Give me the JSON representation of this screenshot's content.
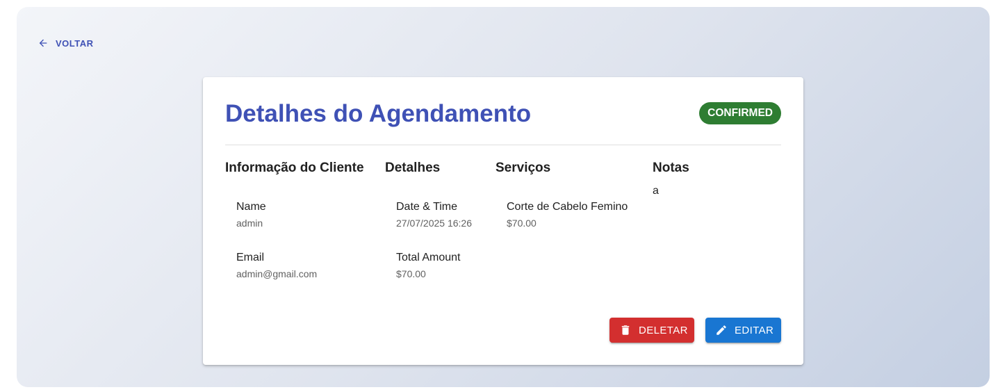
{
  "nav": {
    "back_label": "VOLTAR"
  },
  "card": {
    "title": "Detalhes do Agendamento",
    "status": "CONFIRMED",
    "status_color": "#2e7d32",
    "title_color": "#3f51b5"
  },
  "client": {
    "heading": "Informação do Cliente",
    "name_label": "Name",
    "name_value": "admin",
    "email_label": "Email",
    "email_value": "admin@gmail.com"
  },
  "details": {
    "heading": "Detalhes",
    "datetime_label": "Date & Time",
    "datetime_value": "27/07/2025 16:26",
    "total_label": "Total Amount",
    "total_value": "$70.00"
  },
  "services": {
    "heading": "Serviços",
    "items": [
      {
        "name": "Corte de Cabelo Femino",
        "price": "$70.00"
      }
    ]
  },
  "notes": {
    "heading": "Notas",
    "text": "a"
  },
  "actions": {
    "delete_label": "DELETAR",
    "edit_label": "EDITAR",
    "delete_color": "#d32f2f",
    "edit_color": "#1976d2"
  },
  "icons": {
    "back": "arrow-left-icon",
    "delete": "trash-icon",
    "edit": "pencil-icon"
  }
}
